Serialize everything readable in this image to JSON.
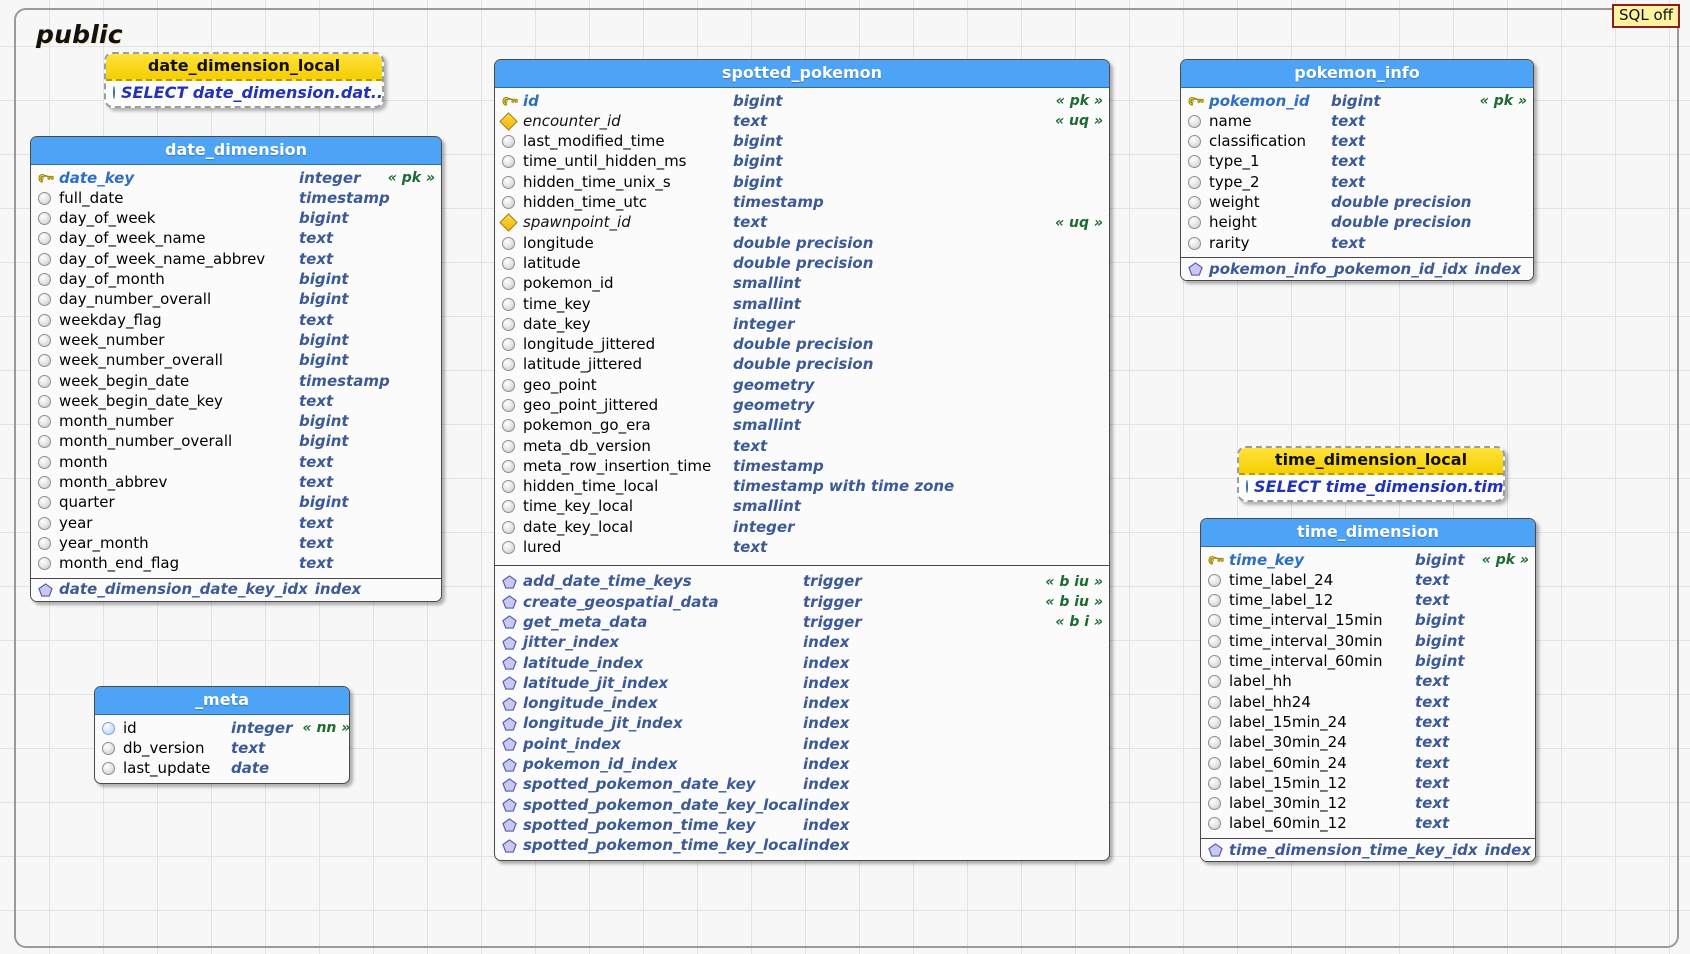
{
  "schema": {
    "title": "public",
    "sql_badge": "SQL off"
  },
  "icons": {
    "pk": "key-icon",
    "column": "circle-icon",
    "unique": "diamond-icon",
    "index": "pentagon-icon",
    "view_column": "blue-circle-icon"
  },
  "views": [
    {
      "name": "date_dimension_local",
      "definition": "SELECT date_dimension.dat..."
    },
    {
      "name": "time_dimension_local",
      "definition": "SELECT time_dimension.tim..."
    }
  ],
  "tables": [
    {
      "name": "date_dimension",
      "columns": [
        {
          "icon": "key-icon",
          "name": "date_key",
          "type": "integer",
          "flag": "« pk »"
        },
        {
          "icon": "circle-icon",
          "name": "full_date",
          "type": "timestamp",
          "flag": ""
        },
        {
          "icon": "circle-icon",
          "name": "day_of_week",
          "type": "bigint",
          "flag": ""
        },
        {
          "icon": "circle-icon",
          "name": "day_of_week_name",
          "type": "text",
          "flag": ""
        },
        {
          "icon": "circle-icon",
          "name": "day_of_week_name_abbrev",
          "type": "text",
          "flag": ""
        },
        {
          "icon": "circle-icon",
          "name": "day_of_month",
          "type": "bigint",
          "flag": ""
        },
        {
          "icon": "circle-icon",
          "name": "day_number_overall",
          "type": "bigint",
          "flag": ""
        },
        {
          "icon": "circle-icon",
          "name": "weekday_flag",
          "type": "text",
          "flag": ""
        },
        {
          "icon": "circle-icon",
          "name": "week_number",
          "type": "bigint",
          "flag": ""
        },
        {
          "icon": "circle-icon",
          "name": "week_number_overall",
          "type": "bigint",
          "flag": ""
        },
        {
          "icon": "circle-icon",
          "name": "week_begin_date",
          "type": "timestamp",
          "flag": ""
        },
        {
          "icon": "circle-icon",
          "name": "week_begin_date_key",
          "type": "text",
          "flag": ""
        },
        {
          "icon": "circle-icon",
          "name": "month_number",
          "type": "bigint",
          "flag": ""
        },
        {
          "icon": "circle-icon",
          "name": "month_number_overall",
          "type": "bigint",
          "flag": ""
        },
        {
          "icon": "circle-icon",
          "name": "month",
          "type": "text",
          "flag": ""
        },
        {
          "icon": "circle-icon",
          "name": "month_abbrev",
          "type": "text",
          "flag": ""
        },
        {
          "icon": "circle-icon",
          "name": "quarter",
          "type": "bigint",
          "flag": ""
        },
        {
          "icon": "circle-icon",
          "name": "year",
          "type": "text",
          "flag": ""
        },
        {
          "icon": "circle-icon",
          "name": "year_month",
          "type": "text",
          "flag": ""
        },
        {
          "icon": "circle-icon",
          "name": "month_end_flag",
          "type": "text",
          "flag": ""
        }
      ],
      "footer": {
        "icon": "pentagon-icon",
        "name": "date_dimension_date_key_idx",
        "type": "index"
      }
    },
    {
      "name": "_meta",
      "columns": [
        {
          "icon": "blue-circle-icon",
          "name": "id",
          "type": "integer",
          "flag": "« nn »"
        },
        {
          "icon": "circle-icon",
          "name": "db_version",
          "type": "text",
          "flag": ""
        },
        {
          "icon": "circle-icon",
          "name": "last_update",
          "type": "date",
          "flag": ""
        }
      ],
      "footer": null
    },
    {
      "name": "spotted_pokemon",
      "columns": [
        {
          "icon": "key-icon",
          "name": "id",
          "type": "bigint",
          "flag": "« pk »"
        },
        {
          "icon": "diamond-icon",
          "name": "encounter_id",
          "type": "text",
          "flag": "« uq »"
        },
        {
          "icon": "circle-icon",
          "name": "last_modified_time",
          "type": "bigint",
          "flag": ""
        },
        {
          "icon": "circle-icon",
          "name": "time_until_hidden_ms",
          "type": "bigint",
          "flag": ""
        },
        {
          "icon": "circle-icon",
          "name": "hidden_time_unix_s",
          "type": "bigint",
          "flag": ""
        },
        {
          "icon": "circle-icon",
          "name": "hidden_time_utc",
          "type": "timestamp",
          "flag": ""
        },
        {
          "icon": "diamond-icon",
          "name": "spawnpoint_id",
          "type": "text",
          "flag": "« uq »"
        },
        {
          "icon": "circle-icon",
          "name": "longitude",
          "type": "double precision",
          "flag": ""
        },
        {
          "icon": "circle-icon",
          "name": "latitude",
          "type": "double precision",
          "flag": ""
        },
        {
          "icon": "circle-icon",
          "name": "pokemon_id",
          "type": "smallint",
          "flag": ""
        },
        {
          "icon": "circle-icon",
          "name": "time_key",
          "type": "smallint",
          "flag": ""
        },
        {
          "icon": "circle-icon",
          "name": "date_key",
          "type": "integer",
          "flag": ""
        },
        {
          "icon": "circle-icon",
          "name": "longitude_jittered",
          "type": "double precision",
          "flag": ""
        },
        {
          "icon": "circle-icon",
          "name": "latitude_jittered",
          "type": "double precision",
          "flag": ""
        },
        {
          "icon": "circle-icon",
          "name": "geo_point",
          "type": "geometry",
          "flag": ""
        },
        {
          "icon": "circle-icon",
          "name": "geo_point_jittered",
          "type": "geometry",
          "flag": ""
        },
        {
          "icon": "circle-icon",
          "name": "pokemon_go_era",
          "type": "smallint",
          "flag": ""
        },
        {
          "icon": "circle-icon",
          "name": "meta_db_version",
          "type": "text",
          "flag": ""
        },
        {
          "icon": "circle-icon",
          "name": "meta_row_insertion_time",
          "type": "timestamp",
          "flag": ""
        },
        {
          "icon": "circle-icon",
          "name": "hidden_time_local",
          "type": "timestamp with time zone",
          "flag": ""
        },
        {
          "icon": "circle-icon",
          "name": "time_key_local",
          "type": "smallint",
          "flag": ""
        },
        {
          "icon": "circle-icon",
          "name": "date_key_local",
          "type": "integer",
          "flag": ""
        },
        {
          "icon": "circle-icon",
          "name": "lured",
          "type": "text",
          "flag": ""
        }
      ],
      "objects": [
        {
          "icon": "pentagon-icon",
          "name": "add_date_time_keys",
          "type": "trigger",
          "flag": "« b iu »"
        },
        {
          "icon": "pentagon-icon",
          "name": "create_geospatial_data",
          "type": "trigger",
          "flag": "« b iu »"
        },
        {
          "icon": "pentagon-icon",
          "name": "get_meta_data",
          "type": "trigger",
          "flag": "« b i »"
        },
        {
          "icon": "pentagon-icon",
          "name": "jitter_index",
          "type": "index",
          "flag": ""
        },
        {
          "icon": "pentagon-icon",
          "name": "latitude_index",
          "type": "index",
          "flag": ""
        },
        {
          "icon": "pentagon-icon",
          "name": "latitude_jit_index",
          "type": "index",
          "flag": ""
        },
        {
          "icon": "pentagon-icon",
          "name": "longitude_index",
          "type": "index",
          "flag": ""
        },
        {
          "icon": "pentagon-icon",
          "name": "longitude_jit_index",
          "type": "index",
          "flag": ""
        },
        {
          "icon": "pentagon-icon",
          "name": "point_index",
          "type": "index",
          "flag": ""
        },
        {
          "icon": "pentagon-icon",
          "name": "pokemon_id_index",
          "type": "index",
          "flag": ""
        },
        {
          "icon": "pentagon-icon",
          "name": "spotted_pokemon_date_key",
          "type": "index",
          "flag": ""
        },
        {
          "icon": "pentagon-icon",
          "name": "spotted_pokemon_date_key_local",
          "type": "index",
          "flag": ""
        },
        {
          "icon": "pentagon-icon",
          "name": "spotted_pokemon_time_key",
          "type": "index",
          "flag": ""
        },
        {
          "icon": "pentagon-icon",
          "name": "spotted_pokemon_time_key_local",
          "type": "index",
          "flag": ""
        }
      ],
      "footer": null
    },
    {
      "name": "pokemon_info",
      "columns": [
        {
          "icon": "key-icon",
          "name": "pokemon_id",
          "type": "bigint",
          "flag": "« pk »"
        },
        {
          "icon": "circle-icon",
          "name": "name",
          "type": "text",
          "flag": ""
        },
        {
          "icon": "circle-icon",
          "name": "classification",
          "type": "text",
          "flag": ""
        },
        {
          "icon": "circle-icon",
          "name": "type_1",
          "type": "text",
          "flag": ""
        },
        {
          "icon": "circle-icon",
          "name": "type_2",
          "type": "text",
          "flag": ""
        },
        {
          "icon": "circle-icon",
          "name": "weight",
          "type": "double precision",
          "flag": ""
        },
        {
          "icon": "circle-icon",
          "name": "height",
          "type": "double precision",
          "flag": ""
        },
        {
          "icon": "circle-icon",
          "name": "rarity",
          "type": "text",
          "flag": ""
        }
      ],
      "footer": {
        "icon": "pentagon-icon",
        "name": "pokemon_info_pokemon_id_idx",
        "type": "index"
      }
    },
    {
      "name": "time_dimension",
      "columns": [
        {
          "icon": "key-icon",
          "name": "time_key",
          "type": "bigint",
          "flag": "« pk »"
        },
        {
          "icon": "circle-icon",
          "name": "time_label_24",
          "type": "text",
          "flag": ""
        },
        {
          "icon": "circle-icon",
          "name": "time_label_12",
          "type": "text",
          "flag": ""
        },
        {
          "icon": "circle-icon",
          "name": "time_interval_15min",
          "type": "bigint",
          "flag": ""
        },
        {
          "icon": "circle-icon",
          "name": "time_interval_30min",
          "type": "bigint",
          "flag": ""
        },
        {
          "icon": "circle-icon",
          "name": "time_interval_60min",
          "type": "bigint",
          "flag": ""
        },
        {
          "icon": "circle-icon",
          "name": "label_hh",
          "type": "text",
          "flag": ""
        },
        {
          "icon": "circle-icon",
          "name": "label_hh24",
          "type": "text",
          "flag": ""
        },
        {
          "icon": "circle-icon",
          "name": "label_15min_24",
          "type": "text",
          "flag": ""
        },
        {
          "icon": "circle-icon",
          "name": "label_30min_24",
          "type": "text",
          "flag": ""
        },
        {
          "icon": "circle-icon",
          "name": "label_60min_24",
          "type": "text",
          "flag": ""
        },
        {
          "icon": "circle-icon",
          "name": "label_15min_12",
          "type": "text",
          "flag": ""
        },
        {
          "icon": "circle-icon",
          "name": "label_30min_12",
          "type": "text",
          "flag": ""
        },
        {
          "icon": "circle-icon",
          "name": "label_60min_12",
          "type": "text",
          "flag": ""
        }
      ],
      "footer": {
        "icon": "pentagon-icon",
        "name": "time_dimension_time_key_idx",
        "type": "index"
      }
    }
  ]
}
